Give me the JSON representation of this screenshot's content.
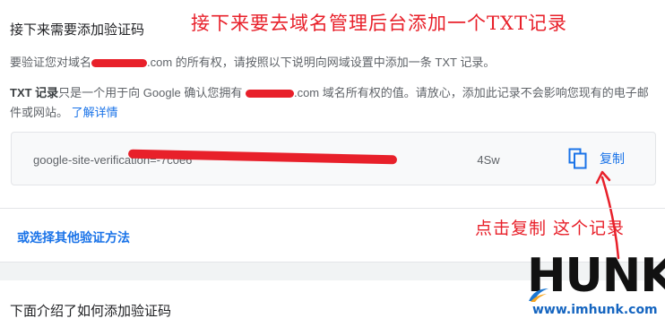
{
  "header": {
    "title": "接下来需要添加验证码",
    "annotation": "接下来要去域名管理后台添加一个TXT记录"
  },
  "intro": {
    "prefix": "要验证您对域名",
    "domain_suffix": ".com 的所有权，请按照以下说明向网域设置中添加一条 TXT 记录。"
  },
  "explanation": {
    "bold_label": "TXT 记录",
    "text_a": "只是一个用于向 Google 确认您拥有",
    "text_b": ".com 域名所有权的值。请放心，添加此记录不会影响您现有的电子邮件或网站。",
    "learn_more": "了解详情"
  },
  "verification": {
    "code_prefix": "google-site-verification=-7c0e6",
    "code_suffix": "4Sw",
    "copy_label": "复制",
    "copy_icon": "copy-icon"
  },
  "actions": {
    "other_methods": "或选择其他验证方法"
  },
  "annotations": {
    "click_copy": "点击复制 这个记录"
  },
  "footer": {
    "subtitle": "下面介绍了如何添加验证码"
  },
  "watermark": {
    "word": "HUNK",
    "url": "www.imhunk.com"
  },
  "colors": {
    "accent": "#1a73e8",
    "annotation_red": "#e8202a",
    "text_primary": "#202124",
    "text_secondary": "#5f6368"
  }
}
